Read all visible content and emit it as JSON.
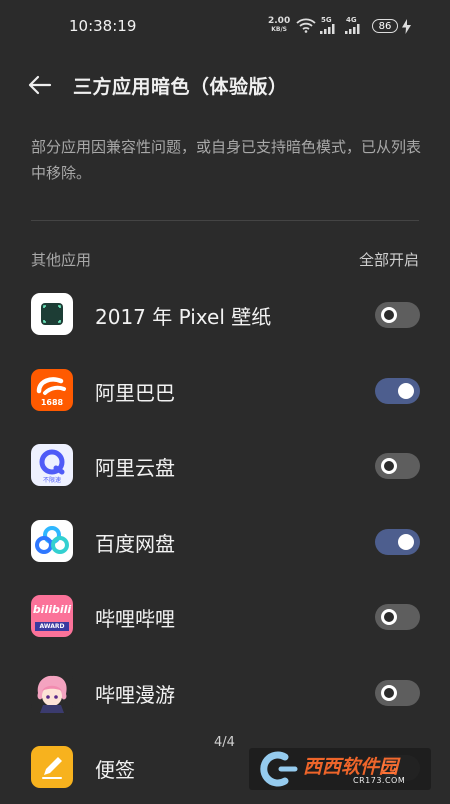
{
  "status_bar": {
    "time": "10:38:19",
    "net_speed_value": "2.00",
    "net_speed_unit": "KB/S",
    "signal1_label": "5G",
    "signal2_label": "4G",
    "battery": "86"
  },
  "header": {
    "title": "三方应用暗色（体验版）"
  },
  "description": "部分应用因兼容性问题，或自身已支持暗色模式，已从列表中移除。",
  "section": {
    "label": "其他应用",
    "enable_all": "全部开启"
  },
  "apps": [
    {
      "name": "2017 年 Pixel 壁纸",
      "icon": "pixel-wallpaper-icon",
      "enabled": false
    },
    {
      "name": "阿里巴巴",
      "icon": "alibaba-icon",
      "icon_text": "1688",
      "enabled": true
    },
    {
      "name": "阿里云盘",
      "icon": "aliyun-drive-icon",
      "icon_text": "不限速",
      "enabled": false
    },
    {
      "name": "百度网盘",
      "icon": "baidu-netdisk-icon",
      "enabled": true
    },
    {
      "name": "哔哩哔哩",
      "icon": "bilibili-icon",
      "icon_text": "bilibili",
      "icon_subtext": "AWARD",
      "enabled": false
    },
    {
      "name": "哔哩漫游",
      "icon": "bilibili-roaming-icon",
      "enabled": false
    },
    {
      "name": "便签",
      "icon": "notes-icon",
      "enabled": false
    }
  ],
  "page_indicator": "4/4",
  "watermark": {
    "brand": "西西软件园",
    "url": "CR173.COM"
  },
  "colors": {
    "background": "#2b2b2b",
    "toggle_on": "#4d5e8e",
    "toggle_off": "#5e5e5e"
  }
}
